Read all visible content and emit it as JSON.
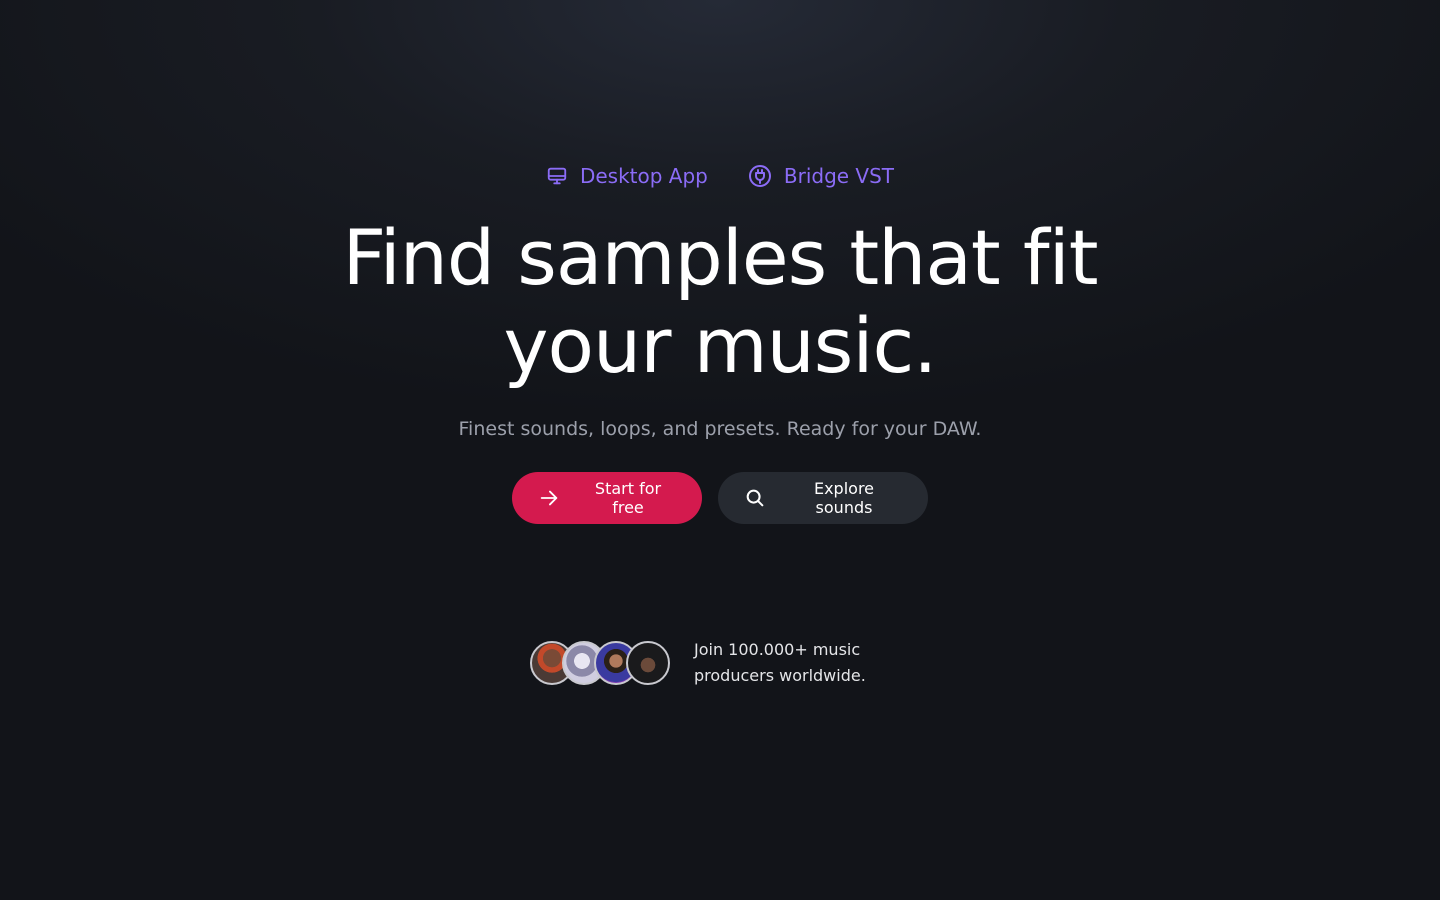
{
  "top_links": [
    {
      "label": "Desktop App",
      "icon": "desktop-monitor-icon"
    },
    {
      "label": "Bridge VST",
      "icon": "plug-icon"
    }
  ],
  "headline": {
    "line1": "Find samples that fit",
    "line2": "your music."
  },
  "subtitle": "Finest sounds, loops, and presets. Ready for your DAW.",
  "cta": {
    "primary_label": "Start for free",
    "primary_icon": "arrow-right-icon",
    "secondary_label": "Explore sounds",
    "secondary_icon": "search-icon"
  },
  "social_proof": {
    "text": "Join 100.000+ music producers worldwide.",
    "avatar_count": 4
  },
  "colors": {
    "accent_purple": "#8b6cf6",
    "primary_button": "#d41a4e",
    "secondary_button": "#262a31",
    "background": "#121419"
  }
}
